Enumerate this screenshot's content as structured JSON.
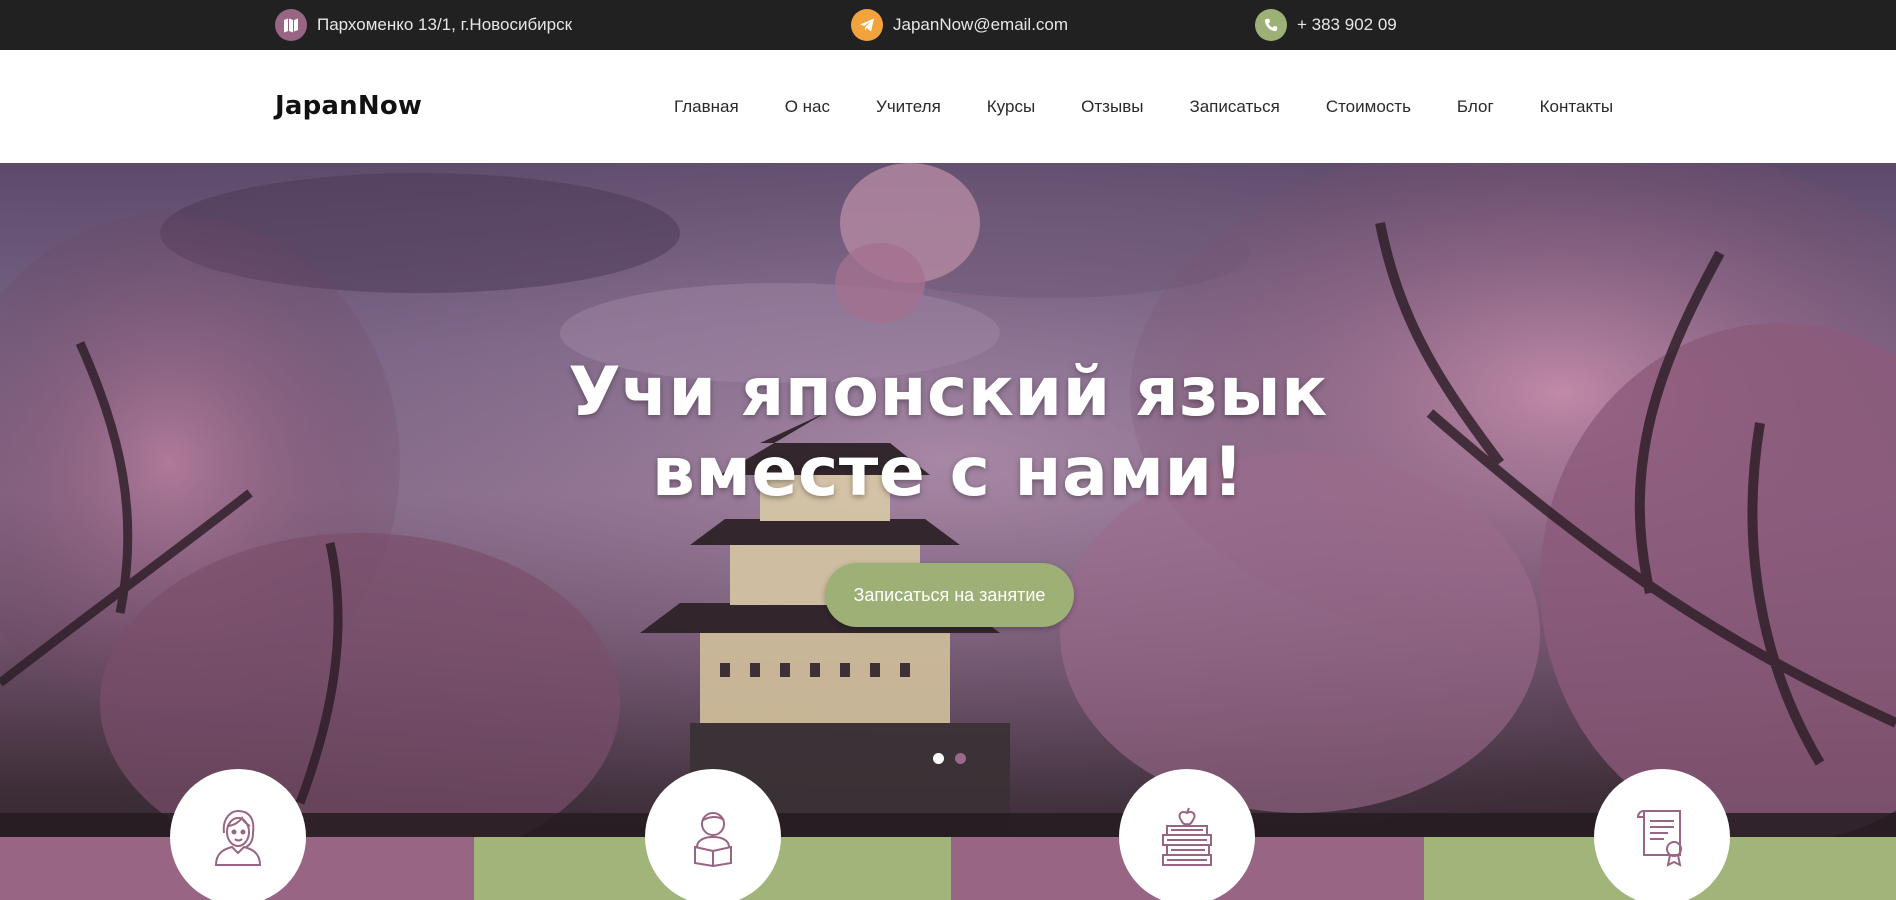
{
  "topbar": {
    "address": "Пархоменко 13/1, г.Новосибирск",
    "email": "JapanNow@email.com",
    "phone": "+ 383 902 09",
    "colors": {
      "address_icon": "#986584",
      "email_icon": "#f2a33c",
      "phone_icon": "#9db176"
    },
    "icons": {
      "address": "map-icon",
      "email": "telegram-icon",
      "phone": "phone-icon"
    }
  },
  "header": {
    "logo": "JapanNow",
    "nav": [
      "Главная",
      "О нас",
      "Учителя",
      "Курсы",
      "Отзывы",
      "Записаться",
      "Стоимость",
      "Блог",
      "Контакты"
    ]
  },
  "hero": {
    "title_line1": "Учи японский язык",
    "title_line2": "вместе с нами!",
    "cta": "Записаться на занятие",
    "slide_current": 1,
    "slide_count": 2
  },
  "features": {
    "icons": [
      "woman-teacher-icon",
      "student-reading-icon",
      "books-apple-icon",
      "certificate-icon"
    ]
  },
  "colors": {
    "accent_purple": "#986584",
    "accent_green": "#a1b47a",
    "topbar_bg": "#212121",
    "cta_bg": "#9db176"
  }
}
